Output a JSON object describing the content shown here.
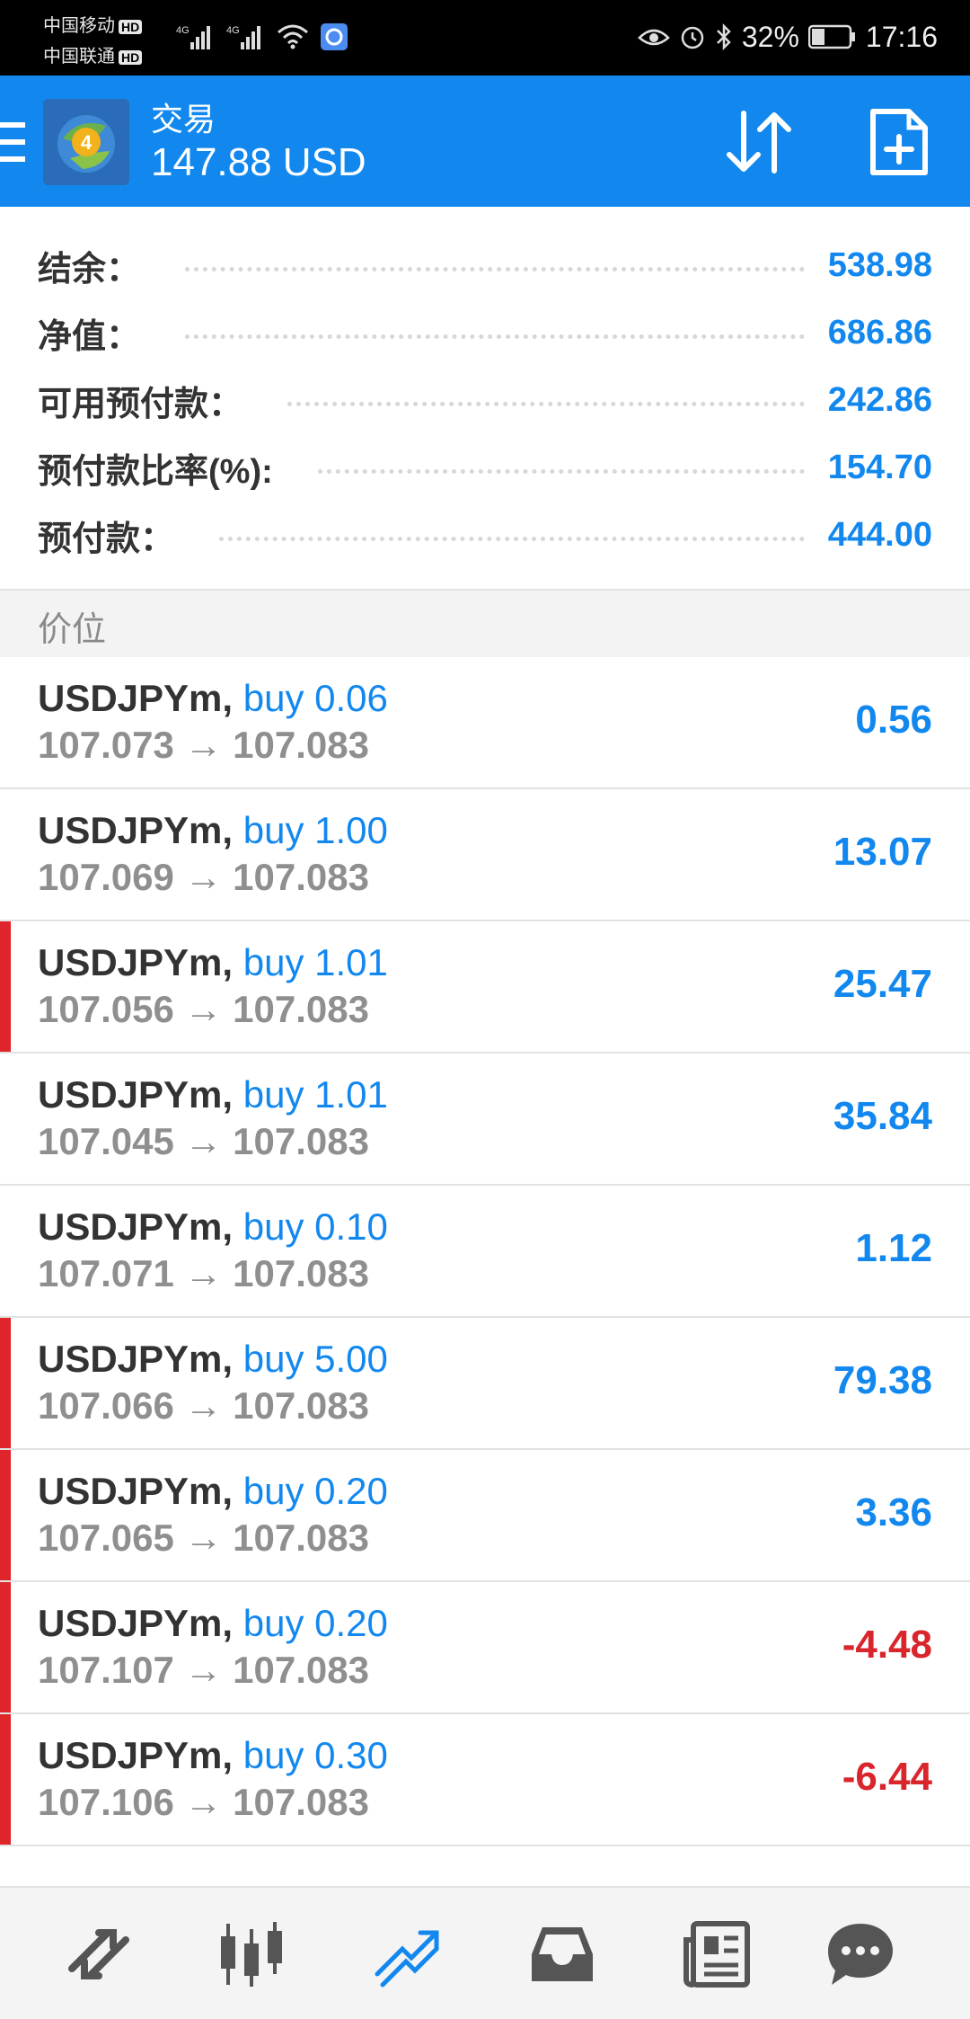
{
  "status_bar": {
    "carrier1": "中国移动",
    "carrier2": "中国联通",
    "hd_badge": "HD",
    "network1": "4G",
    "network2": "4G",
    "battery_percent": "32%",
    "time": "17:16"
  },
  "header": {
    "title": "交易",
    "balance_display": "147.88 USD",
    "icons": [
      "menu-icon",
      "mt4-logo",
      "sort-icon",
      "new-order-icon"
    ]
  },
  "summary": [
    {
      "label": "结余：",
      "value": "538.98"
    },
    {
      "label": "净值：",
      "value": "686.86"
    },
    {
      "label": "可用预付款：",
      "value": "242.86"
    },
    {
      "label": "预付款比率(%):",
      "value": "154.70"
    },
    {
      "label": "预付款：",
      "value": "444.00"
    }
  ],
  "section_title": "价位",
  "positions": [
    {
      "symbol": "USDJPYm,",
      "side": "buy 0.06",
      "open": "107.073",
      "arrow": "→",
      "current": "107.083",
      "profit": "0.56",
      "marked": false
    },
    {
      "symbol": "USDJPYm,",
      "side": "buy 1.00",
      "open": "107.069",
      "arrow": "→",
      "current": "107.083",
      "profit": "13.07",
      "marked": false
    },
    {
      "symbol": "USDJPYm,",
      "side": "buy 1.01",
      "open": "107.056",
      "arrow": "→",
      "current": "107.083",
      "profit": "25.47",
      "marked": true
    },
    {
      "symbol": "USDJPYm,",
      "side": "buy 1.01",
      "open": "107.045",
      "arrow": "→",
      "current": "107.083",
      "profit": "35.84",
      "marked": false
    },
    {
      "symbol": "USDJPYm,",
      "side": "buy 0.10",
      "open": "107.071",
      "arrow": "→",
      "current": "107.083",
      "profit": "1.12",
      "marked": false
    },
    {
      "symbol": "USDJPYm,",
      "side": "buy 5.00",
      "open": "107.066",
      "arrow": "→",
      "current": "107.083",
      "profit": "79.38",
      "marked": true
    },
    {
      "symbol": "USDJPYm,",
      "side": "buy 0.20",
      "open": "107.065",
      "arrow": "→",
      "current": "107.083",
      "profit": "3.36",
      "marked": true
    },
    {
      "symbol": "USDJPYm,",
      "side": "buy 0.20",
      "open": "107.107",
      "arrow": "→",
      "current": "107.083",
      "profit": "-4.48",
      "marked": true
    },
    {
      "symbol": "USDJPYm,",
      "side": "buy 0.30",
      "open": "107.106",
      "arrow": "→",
      "current": "107.083",
      "profit": "-6.44",
      "marked": true
    }
  ],
  "bottom_nav": [
    {
      "icon": "quotes-icon",
      "active": false
    },
    {
      "icon": "chart-icon",
      "active": false
    },
    {
      "icon": "trade-icon",
      "active": true
    },
    {
      "icon": "history-icon",
      "active": false
    },
    {
      "icon": "news-icon",
      "active": false
    },
    {
      "icon": "chat-icon",
      "active": false
    }
  ],
  "colors": {
    "accent": "#1288ef",
    "negative": "#d9262d",
    "marker": "#e0242b",
    "nav_inactive": "#555555"
  }
}
